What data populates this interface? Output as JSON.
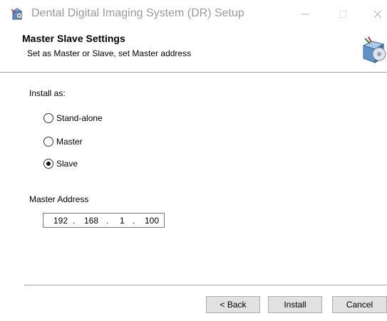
{
  "window": {
    "title": "Dental Digital Imaging System (DR) Setup",
    "icon": "installer-app-icon",
    "controls": {
      "minimize_icon": "minimize-icon",
      "maximize_icon": "maximize-icon",
      "close_icon": "close-icon"
    }
  },
  "header": {
    "title": "Master Slave Settings",
    "subtitle": "Set as Master or Slave, set Master address",
    "icon": "installer-box-icon"
  },
  "install_as": {
    "label": "Install as:",
    "options": [
      {
        "label": "Stand-alone",
        "checked": false
      },
      {
        "label": "Master",
        "checked": false
      },
      {
        "label": "Slave",
        "checked": true
      }
    ],
    "selected": "Slave"
  },
  "master_address": {
    "label": "Master Address",
    "octets": [
      "192",
      "168",
      "1",
      "100"
    ],
    "separator": "."
  },
  "buttons": {
    "back": "< Back",
    "install": "Install",
    "cancel": "Cancel"
  },
  "colors": {
    "title_text": "#9a9a9a",
    "button_face": "#e1e1e1",
    "button_border": "#adadad",
    "divider": "#a0a0a0"
  }
}
